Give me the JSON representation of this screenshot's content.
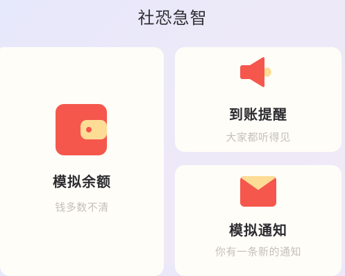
{
  "header": {
    "title": "社恐急智"
  },
  "cards": {
    "wallet": {
      "title": "模拟余额",
      "subtitle": "钱多数不清",
      "icon": "wallet-icon"
    },
    "payment_alert": {
      "title": "到账提醒",
      "subtitle": "大家都听得见",
      "icon": "megaphone-icon"
    },
    "notification": {
      "title": "模拟通知",
      "subtitle": "你有一条新的通知",
      "icon": "envelope-icon"
    }
  },
  "colors": {
    "accent_red": "#f5574d",
    "accent_yellow": "#fddc95",
    "card_background": "#fffdf8",
    "page_background": "#ebe9f9"
  }
}
